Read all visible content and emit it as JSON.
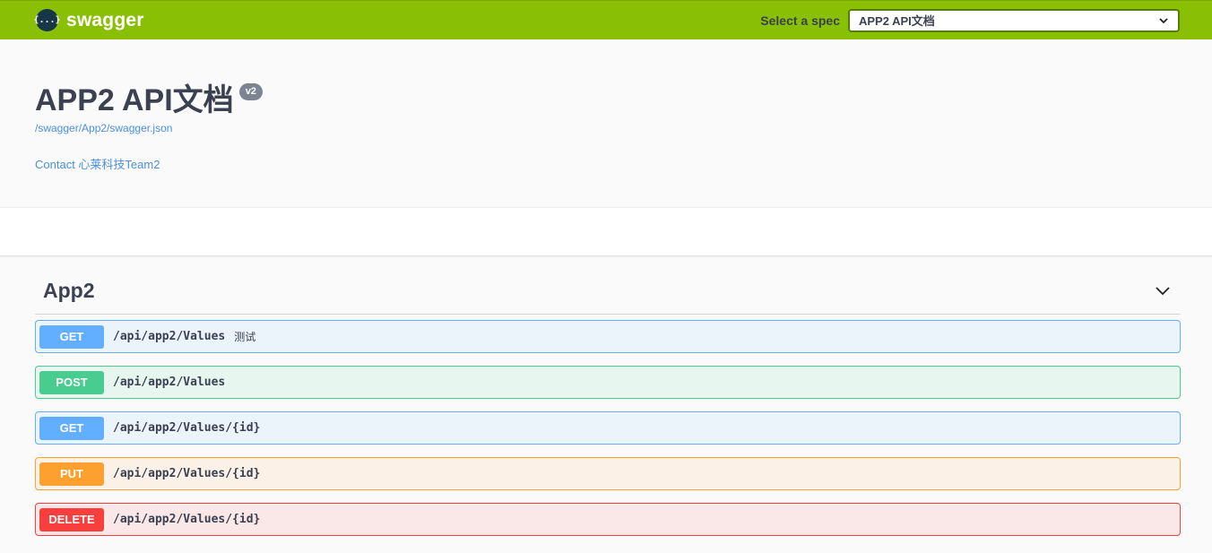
{
  "topbar": {
    "logo_glyph": "{...}",
    "brand": "swagger",
    "spec_label": "Select a spec",
    "spec_value": "APP2 API文档",
    "brand_color": "#89bf04"
  },
  "info": {
    "title": "APP2 API文档",
    "version": "v2",
    "url": "/swagger/App2/swagger.json",
    "contact": "Contact 心莱科技Team2"
  },
  "tag": {
    "name": "App2"
  },
  "operations": [
    {
      "method": "GET",
      "path": "/api/app2/Values",
      "summary": "测试",
      "color": "#61affe"
    },
    {
      "method": "POST",
      "path": "/api/app2/Values",
      "summary": "",
      "color": "#49cc90"
    },
    {
      "method": "GET",
      "path": "/api/app2/Values/{id}",
      "summary": "",
      "color": "#61affe"
    },
    {
      "method": "PUT",
      "path": "/api/app2/Values/{id}",
      "summary": "",
      "color": "#fca130"
    },
    {
      "method": "DELETE",
      "path": "/api/app2/Values/{id}",
      "summary": "",
      "color": "#f93e3e"
    }
  ]
}
